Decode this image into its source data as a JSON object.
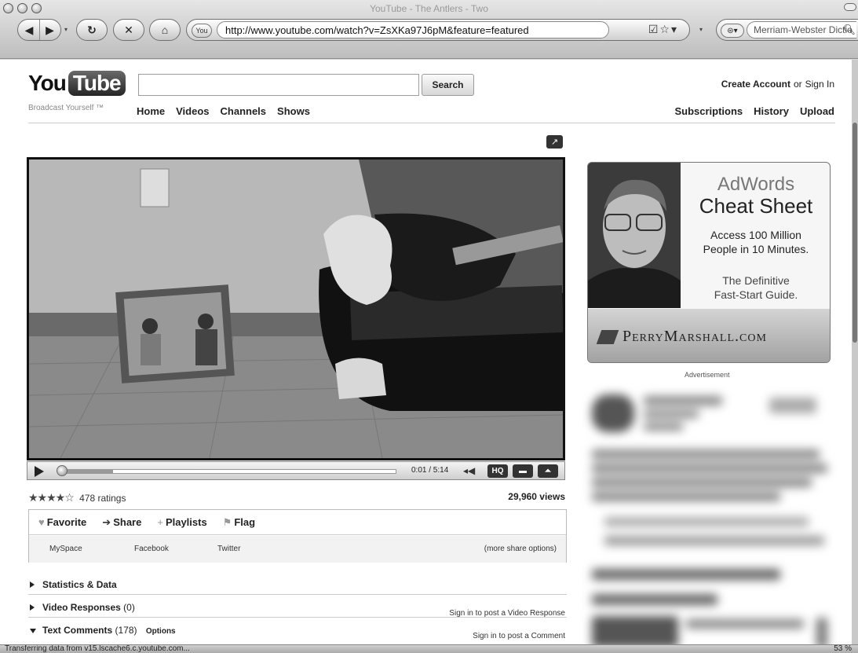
{
  "window": {
    "title": "YouTube - The Antlers - Two"
  },
  "browser": {
    "url": "http://www.youtube.com/watch?v=ZsXKa97J6pM&feature=featured",
    "url_icons": "☑☆▾",
    "search_placeholder": "Merriam-Webster Dictio",
    "search_icon": "magnifier-icon"
  },
  "youtube": {
    "logo": {
      "you": "You",
      "tube": "Tube"
    },
    "tagline": "Broadcast Yourself ™",
    "search_button": "Search",
    "nav": [
      "Home",
      "Videos",
      "Channels",
      "Shows"
    ],
    "account": {
      "create": "Create Account",
      "or": "or",
      "sign_in": "Sign In"
    },
    "user_nav": [
      "Subscriptions",
      "History",
      "Upload"
    ]
  },
  "player": {
    "time": "0:01 / 5:14",
    "progress_fraction": 0.003,
    "buffered_fraction": 0.16,
    "hq_label": "HQ"
  },
  "stats": {
    "stars": "★★★★☆",
    "ratings": "478 ratings",
    "views": "29,960 views"
  },
  "actions": {
    "tabs": [
      {
        "icon": "♥",
        "label": "Favorite"
      },
      {
        "icon": "➔",
        "label": "Share"
      },
      {
        "icon": "+",
        "label": "Playlists"
      },
      {
        "icon": "⚑",
        "label": "Flag"
      }
    ],
    "share": {
      "myspace": "MySpace",
      "facebook": "Facebook",
      "twitter": "Twitter",
      "more": "(more share options)"
    }
  },
  "sections": {
    "stats": {
      "title": "Statistics & Data"
    },
    "responses": {
      "title": "Video Responses",
      "count": "(0)",
      "right": "Sign in to post a Video Response"
    },
    "comments": {
      "title": "Text Comments",
      "count": "(178)",
      "options": "Options",
      "right": "Sign in to post a Comment"
    }
  },
  "ad": {
    "brand": "AdWords",
    "headline": "Cheat Sheet",
    "sub1": "Access 100 Million",
    "sub2": "People in 10 Minutes.",
    "sub3": "The Definitive",
    "sub4": "Fast-Start Guide.",
    "site": "PerryMarshall.com",
    "label": "Advertisement"
  },
  "status_bar": {
    "text": "Transferring data from v15.lscache6.c.youtube.com...",
    "right": "53 %"
  }
}
